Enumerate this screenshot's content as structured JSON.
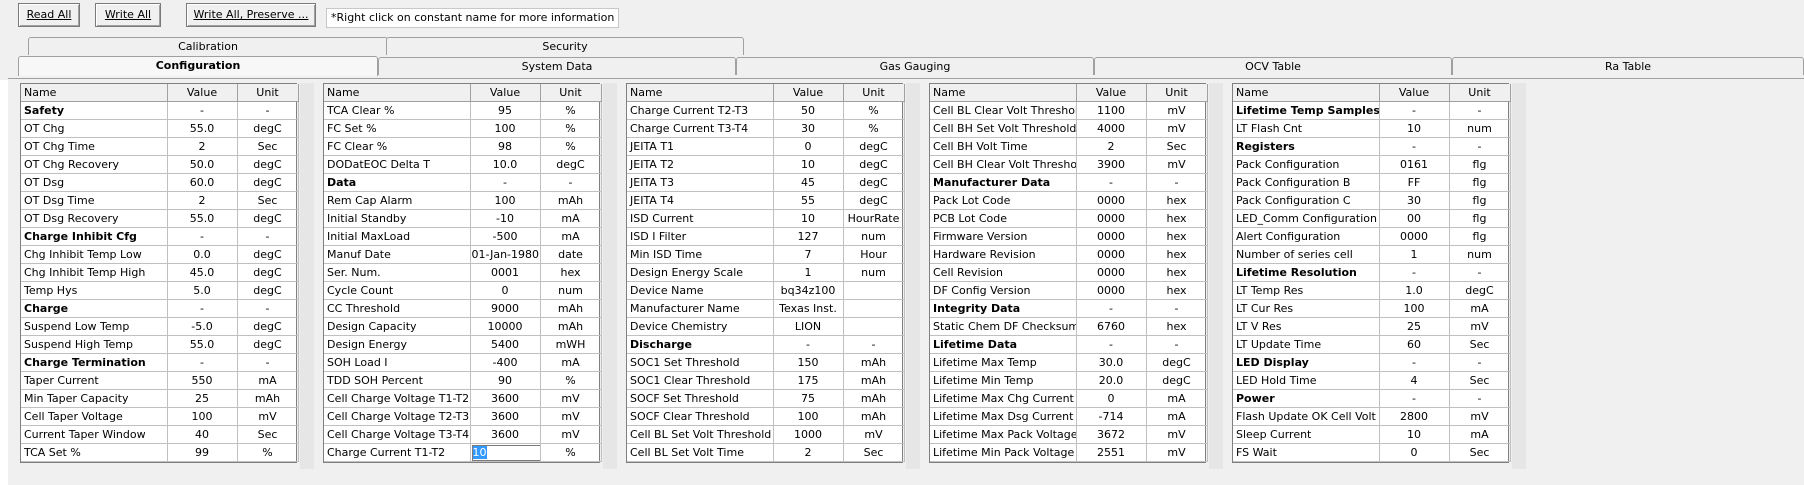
{
  "toolbar": {
    "read_all": "Read All",
    "write_all": "Write All",
    "write_all_preserve": "Write All, Preserve ...",
    "hint": "*Right click on constant name for more information"
  },
  "tabs_row1": [
    "Calibration",
    "Security"
  ],
  "tabs_row2": [
    "Configuration",
    "System Data",
    "Gas Gauging",
    "OCV Table",
    "Ra Table"
  ],
  "headers": {
    "name": "Name",
    "value": "Value",
    "unit": "Unit"
  },
  "tables": [
    {
      "rows": [
        [
          "Safety",
          "-",
          "-",
          1
        ],
        [
          "OT Chg",
          "55.0",
          "degC",
          0
        ],
        [
          "OT Chg Time",
          "2",
          "Sec",
          0
        ],
        [
          "OT Chg Recovery",
          "50.0",
          "degC",
          0
        ],
        [
          "OT Dsg",
          "60.0",
          "degC",
          0
        ],
        [
          "OT Dsg Time",
          "2",
          "Sec",
          0
        ],
        [
          "OT Dsg Recovery",
          "55.0",
          "degC",
          0
        ],
        [
          "Charge Inhibit Cfg",
          "-",
          "-",
          1
        ],
        [
          "Chg Inhibit Temp Low",
          "0.0",
          "degC",
          0
        ],
        [
          "Chg Inhibit Temp High",
          "45.0",
          "degC",
          0
        ],
        [
          "Temp Hys",
          "5.0",
          "degC",
          0
        ],
        [
          "Charge",
          "-",
          "-",
          1
        ],
        [
          "Suspend Low Temp",
          "-5.0",
          "degC",
          0
        ],
        [
          "Suspend High Temp",
          "55.0",
          "degC",
          0
        ],
        [
          "Charge Termination",
          "-",
          "-",
          1
        ],
        [
          "Taper Current",
          "550",
          "mA",
          0
        ],
        [
          "Min Taper Capacity",
          "25",
          "mAh",
          0
        ],
        [
          "Cell Taper Voltage",
          "100",
          "mV",
          0
        ],
        [
          "Current Taper Window",
          "40",
          "Sec",
          0
        ],
        [
          "TCA Set %",
          "99",
          "%",
          0
        ]
      ]
    },
    {
      "rows": [
        [
          "TCA Clear %",
          "95",
          "%",
          0
        ],
        [
          "FC Set %",
          "100",
          "%",
          0
        ],
        [
          "FC Clear %",
          "98",
          "%",
          0
        ],
        [
          "DODatEOC Delta T",
          "10.0",
          "degC",
          0
        ],
        [
          "Data",
          "-",
          "-",
          1
        ],
        [
          "Rem Cap Alarm",
          "100",
          "mAh",
          0
        ],
        [
          "Initial Standby",
          "-10",
          "mA",
          0
        ],
        [
          "Initial MaxLoad",
          "-500",
          "mA",
          0
        ],
        [
          "Manuf Date",
          "01-Jan-1980",
          "date",
          0
        ],
        [
          "Ser. Num.",
          "0001",
          "hex",
          0
        ],
        [
          "Cycle Count",
          "0",
          "num",
          0
        ],
        [
          "CC Threshold",
          "9000",
          "mAh",
          0
        ],
        [
          "Design Capacity",
          "10000",
          "mAh",
          0
        ],
        [
          "Design Energy",
          "5400",
          "mWH",
          0
        ],
        [
          "SOH Load I",
          "-400",
          "mA",
          0
        ],
        [
          "TDD SOH Percent",
          "90",
          "%",
          0
        ],
        [
          "Cell Charge Voltage T1-T2",
          "3600",
          "mV",
          0
        ],
        [
          "Cell Charge Voltage T2-T3",
          "3600",
          "mV",
          0
        ],
        [
          "Cell Charge Voltage T3-T4",
          "3600",
          "mV",
          0
        ],
        [
          "Charge Current T1-T2",
          "10",
          "%",
          2
        ]
      ]
    },
    {
      "rows": [
        [
          "Charge Current T2-T3",
          "50",
          "%",
          0
        ],
        [
          "Charge Current T3-T4",
          "30",
          "%",
          0
        ],
        [
          "JEITA T1",
          "0",
          "degC",
          0
        ],
        [
          "JEITA T2",
          "10",
          "degC",
          0
        ],
        [
          "JEITA T3",
          "45",
          "degC",
          0
        ],
        [
          "JEITA T4",
          "55",
          "degC",
          0
        ],
        [
          "ISD Current",
          "10",
          "HourRate",
          0
        ],
        [
          "ISD I Filter",
          "127",
          "num",
          0
        ],
        [
          "Min ISD Time",
          "7",
          "Hour",
          0
        ],
        [
          "Design Energy Scale",
          "1",
          "num",
          0
        ],
        [
          "Device Name",
          "bq34z100",
          "",
          0
        ],
        [
          "Manufacturer Name",
          "Texas Inst.",
          "",
          0
        ],
        [
          "Device Chemistry",
          "LION",
          "",
          0
        ],
        [
          "Discharge",
          "-",
          "-",
          1
        ],
        [
          "SOC1 Set Threshold",
          "150",
          "mAh",
          0
        ],
        [
          "SOC1 Clear Threshold",
          "175",
          "mAh",
          0
        ],
        [
          "SOCF Set Threshold",
          "75",
          "mAh",
          0
        ],
        [
          "SOCF Clear Threshold",
          "100",
          "mAh",
          0
        ],
        [
          "Cell BL Set Volt Threshold",
          "1000",
          "mV",
          0
        ],
        [
          "Cell BL Set Volt Time",
          "2",
          "Sec",
          0
        ]
      ]
    },
    {
      "rows": [
        [
          "Cell BL Clear Volt Threshold",
          "1100",
          "mV",
          0
        ],
        [
          "Cell BH Set Volt Threshold",
          "4000",
          "mV",
          0
        ],
        [
          "Cell BH Volt Time",
          "2",
          "Sec",
          0
        ],
        [
          "Cell BH Clear Volt Threshold",
          "3900",
          "mV",
          0
        ],
        [
          "Manufacturer Data",
          "-",
          "-",
          1
        ],
        [
          "Pack Lot Code",
          "0000",
          "hex",
          0
        ],
        [
          "PCB Lot Code",
          "0000",
          "hex",
          0
        ],
        [
          "Firmware Version",
          "0000",
          "hex",
          0
        ],
        [
          "Hardware Revision",
          "0000",
          "hex",
          0
        ],
        [
          "Cell Revision",
          "0000",
          "hex",
          0
        ],
        [
          "DF Config Version",
          "0000",
          "hex",
          0
        ],
        [
          "Integrity Data",
          "-",
          "-",
          1
        ],
        [
          "Static Chem DF Checksum",
          "6760",
          "hex",
          0
        ],
        [
          "Lifetime Data",
          "-",
          "-",
          1
        ],
        [
          "Lifetime Max Temp",
          "30.0",
          "degC",
          0
        ],
        [
          "Lifetime Min Temp",
          "20.0",
          "degC",
          0
        ],
        [
          "Lifetime Max Chg Current",
          "0",
          "mA",
          0
        ],
        [
          "Lifetime Max Dsg Current",
          "-714",
          "mA",
          0
        ],
        [
          "Lifetime Max Pack Voltage",
          "3672",
          "mV",
          0
        ],
        [
          "Lifetime Min Pack Voltage",
          "2551",
          "mV",
          0
        ]
      ]
    },
    {
      "rows": [
        [
          "Lifetime Temp Samples",
          "-",
          "-",
          1
        ],
        [
          "LT Flash Cnt",
          "10",
          "num",
          0
        ],
        [
          "Registers",
          "-",
          "-",
          1
        ],
        [
          "Pack Configuration",
          "0161",
          "flg",
          0
        ],
        [
          "Pack Configuration B",
          "FF",
          "flg",
          0
        ],
        [
          "Pack Configuration C",
          "30",
          "flg",
          0
        ],
        [
          "LED_Comm Configuration",
          "00",
          "flg",
          0
        ],
        [
          "Alert Configuration",
          "0000",
          "flg",
          0
        ],
        [
          "Number of series cell",
          "1",
          "num",
          0
        ],
        [
          "Lifetime Resolution",
          "-",
          "-",
          1
        ],
        [
          "LT Temp Res",
          "1.0",
          "degC",
          0
        ],
        [
          "LT Cur Res",
          "100",
          "mA",
          0
        ],
        [
          "LT V Res",
          "25",
          "mV",
          0
        ],
        [
          "LT Update Time",
          "60",
          "Sec",
          0
        ],
        [
          "LED Display",
          "-",
          "-",
          1
        ],
        [
          "LED Hold Time",
          "4",
          "Sec",
          0
        ],
        [
          "Power",
          "-",
          "-",
          1
        ],
        [
          "Flash Update OK Cell Volt",
          "2800",
          "mV",
          0
        ],
        [
          "Sleep Current",
          "10",
          "mA",
          0
        ],
        [
          "FS Wait",
          "0",
          "Sec",
          0
        ]
      ]
    }
  ]
}
